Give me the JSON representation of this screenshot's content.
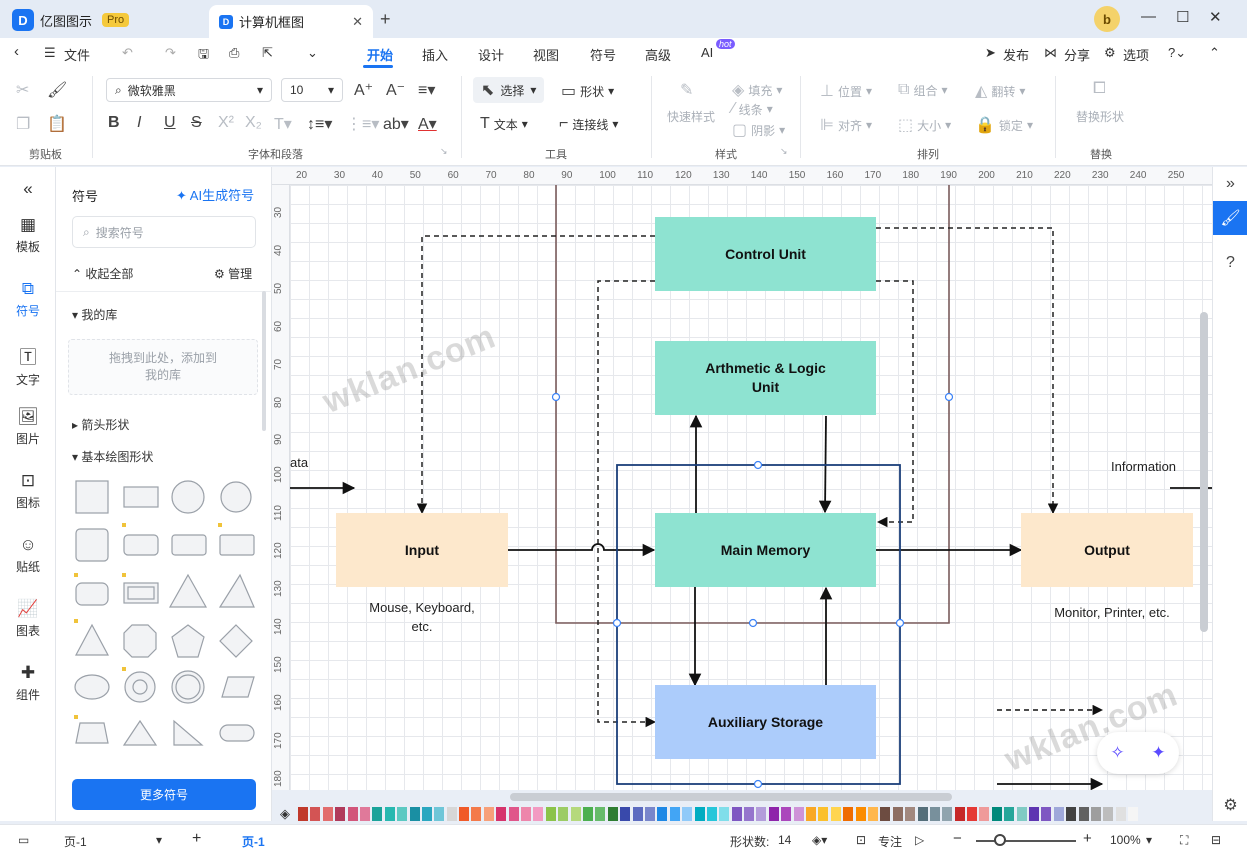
{
  "app": {
    "name": "亿图图示",
    "badge": "Pro"
  },
  "document_tab": {
    "title": "计算机框图"
  },
  "menu": {
    "file": "文件",
    "tabs": [
      "开始",
      "插入",
      "设计",
      "视图",
      "符号",
      "高级",
      "AI"
    ],
    "ai_badge": "hot",
    "publish": "发布",
    "share": "分享",
    "options": "选项"
  },
  "ribbon": {
    "clipboard_label": "剪贴板",
    "font_name": "微软雅黑",
    "font_size": "10",
    "font_group_label": "字体和段落",
    "select": "选择",
    "shape": "形状",
    "text": "文本",
    "connector": "连接线",
    "tools_label": "工具",
    "quick_style": "快速样式",
    "fill": "填充",
    "line": "线条",
    "shadow": "阴影",
    "style_label": "样式",
    "position": "位置",
    "group": "组合",
    "flip": "翻转",
    "align": "对齐",
    "size": "大小",
    "lock": "锁定",
    "arrange_label": "排列",
    "replace_shape": "替换形状",
    "replace_label": "替换"
  },
  "rail": [
    "模板",
    "符号",
    "文字",
    "图片",
    "图标",
    "贴纸",
    "图表",
    "组件"
  ],
  "panel": {
    "title": "符号",
    "ai_generate": "AI生成符号",
    "search_placeholder": "搜索符号",
    "collapse_all": "收起全部",
    "manage": "管理",
    "my_library": "我的库",
    "drop_hint_1": "拖拽到此处，添加到",
    "drop_hint_2": "我的库",
    "arrow_shapes": "箭头形状",
    "basic_shapes": "基本绘图形状",
    "more_button": "更多符号"
  },
  "ruler": {
    "h_ticks": [
      "20",
      "30",
      "40",
      "50",
      "60",
      "70",
      "80",
      "90",
      "100",
      "110",
      "120",
      "130",
      "140",
      "150",
      "160",
      "170",
      "180",
      "190",
      "200",
      "210",
      "220",
      "230",
      "240",
      "250"
    ],
    "v_ticks": [
      "30",
      "40",
      "50",
      "60",
      "70",
      "80",
      "90",
      "100",
      "110",
      "120",
      "130",
      "140",
      "150",
      "160",
      "170",
      "180"
    ]
  },
  "diagram": {
    "control_unit": "Control Unit",
    "alu_line1": "Arthmetic & Logic",
    "alu_line2": "Unit",
    "main_memory": "Main Memory",
    "aux_storage": "Auxiliary Storage",
    "input": "Input",
    "output": "Output",
    "input_caption_1": "Mouse, Keyboard,",
    "input_caption_2": "etc.",
    "output_caption": "Monitor, Printer, etc.",
    "left_label": "ata",
    "right_label": "Information"
  },
  "watermarks": [
    "wklan.com",
    "wklan.com"
  ],
  "colors": {
    "accent": "#1a74f2",
    "teal_box": "#8ee3d1",
    "peach_box": "#fde8cc",
    "blue_box": "#acccfb",
    "palette": [
      "#c0392b",
      "#d35454",
      "#e26d6d",
      "#b03a5b",
      "#d2557a",
      "#e0799a",
      "#1aa39a",
      "#27b8b0",
      "#5cc9c2",
      "#1a8fa3",
      "#2aa7c0",
      "#6fc6d8",
      "#d7d7d7",
      "#f05a28",
      "#f47a4a",
      "#f7a07a",
      "#d6336c",
      "#e0568a",
      "#ed86ab",
      "#f29ac2",
      "#8bc34a",
      "#9ccc65",
      "#b5d97c",
      "#4caf50",
      "#66bb6a",
      "#2e7d32",
      "#3949ab",
      "#5c6bc0",
      "#7986cb",
      "#1e88e5",
      "#42a5f5",
      "#90caf9",
      "#00acc1",
      "#26c6da",
      "#80deea",
      "#7e57c2",
      "#9575cd",
      "#b39ddb",
      "#8e24aa",
      "#ab47bc",
      "#ce93d8",
      "#f9a825",
      "#fbc02d",
      "#ffd54f",
      "#ef6c00",
      "#fb8c00",
      "#ffb74d",
      "#6d4c41",
      "#8d6e63",
      "#a1887f",
      "#546e7a",
      "#78909c",
      "#90a4ae",
      "#c62828",
      "#e53935",
      "#ef9a9a",
      "#00897b",
      "#26a69a",
      "#80cbc4",
      "#5e35b1",
      "#7e57c2",
      "#9fa8da",
      "#424242",
      "#616161",
      "#9e9e9e",
      "#bdbdbd",
      "#e0e0e0",
      "#f5f5f5"
    ]
  },
  "status": {
    "page_selector": "页-1",
    "page_tab": "页-1",
    "shape_count_label": "形状数:",
    "shape_count": "14",
    "focus": "专注",
    "zoom": "100%"
  }
}
